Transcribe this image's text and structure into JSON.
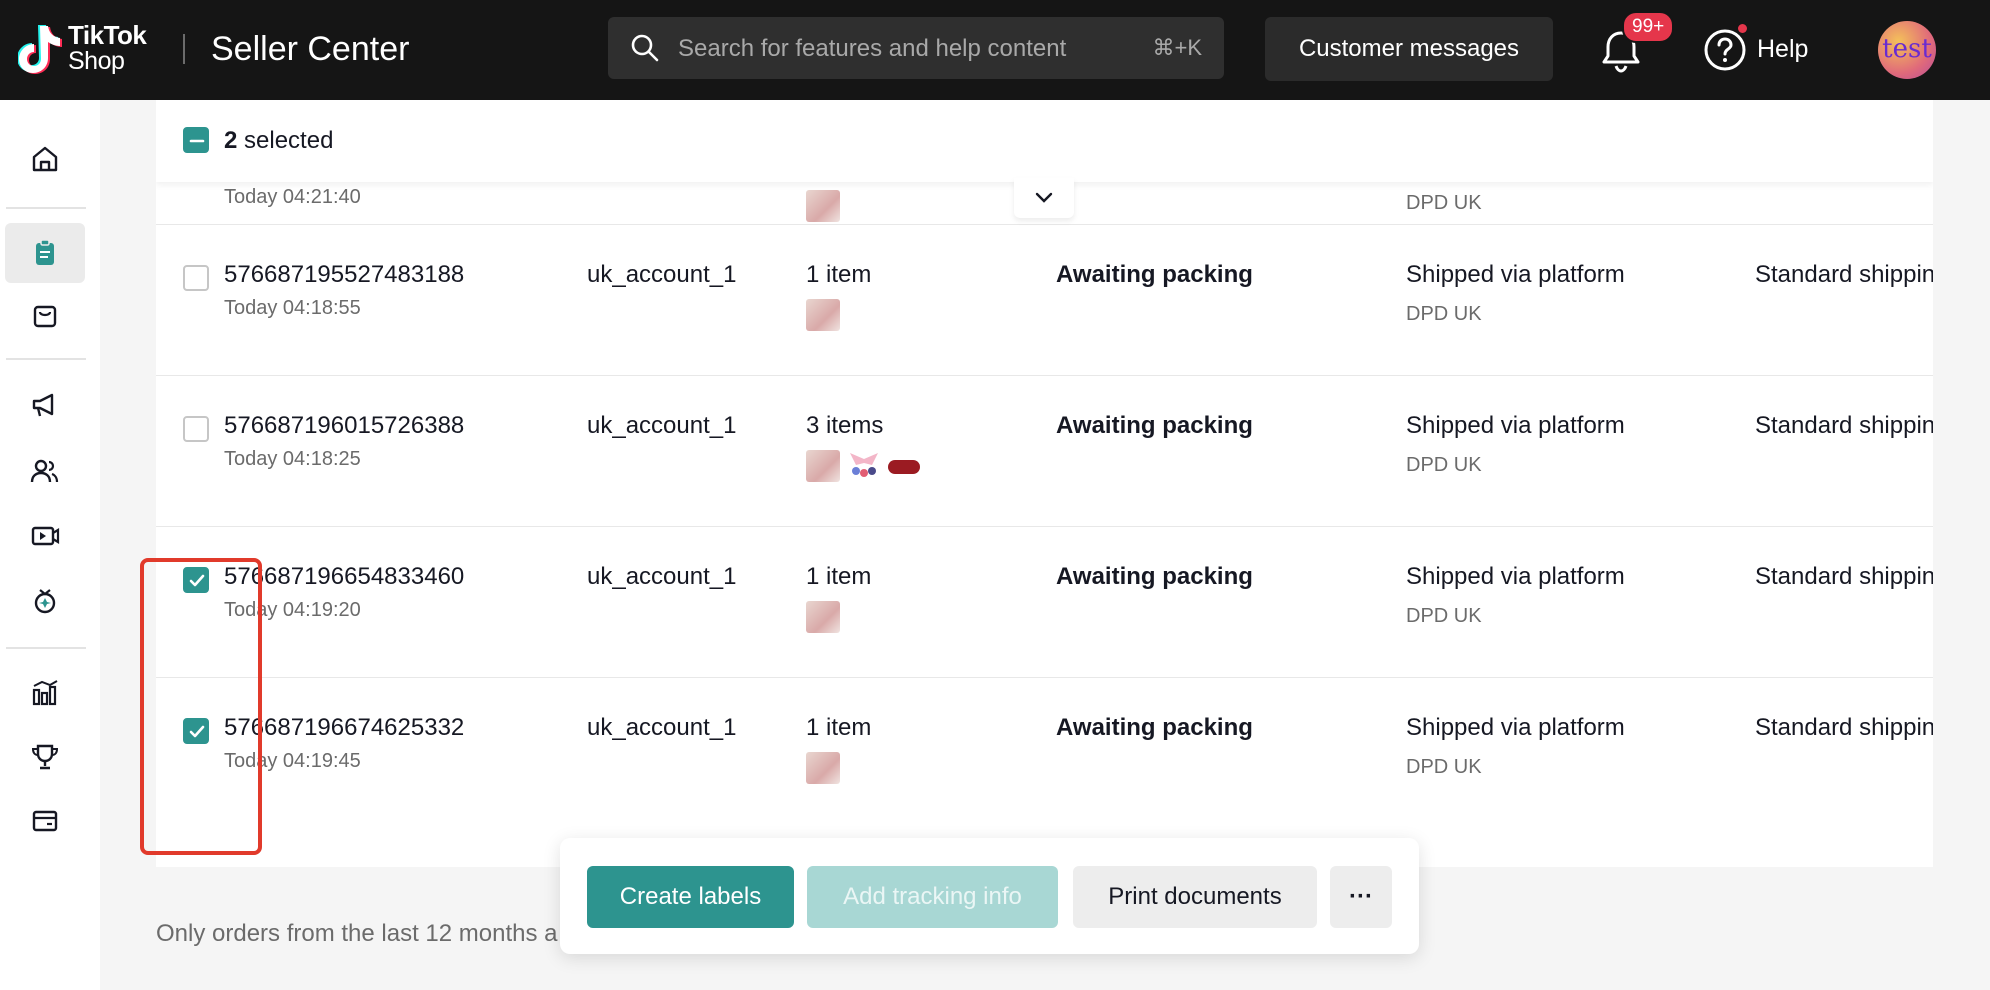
{
  "topbar": {
    "brand_line1": "TikTok",
    "brand_line2": "Shop",
    "title": "Seller Center",
    "search_placeholder": "Search for features and help content",
    "search_shortcut": "⌘+K",
    "customer_messages": "Customer messages",
    "notification_badge": "99+",
    "help_label": "Help",
    "avatar_text": "test"
  },
  "sidebar": {
    "items": [
      {
        "icon": "home-icon"
      },
      {
        "icon": "orders-icon",
        "active": true
      },
      {
        "icon": "products-icon"
      },
      {
        "icon": "marketing-icon"
      },
      {
        "icon": "creators-icon"
      },
      {
        "icon": "live-video-icon"
      },
      {
        "icon": "growth-icon"
      },
      {
        "icon": "analytics-icon"
      },
      {
        "icon": "trophy-icon"
      },
      {
        "icon": "finance-icon"
      }
    ]
  },
  "selection": {
    "count": "2",
    "label": "selected"
  },
  "rows": [
    {
      "id": "",
      "time": "Today 04:21:40",
      "account": "",
      "items": "",
      "status": "",
      "shipping": "",
      "carrier": "DPD UK",
      "method": "",
      "checked": false
    },
    {
      "id": "576687195527483188",
      "time": "Today 04:18:55",
      "account": "uk_account_1",
      "items": "1 item",
      "status": "Awaiting packing",
      "shipping": "Shipped via platform",
      "carrier": "DPD UK",
      "method": "Standard shippin",
      "checked": false
    },
    {
      "id": "576687196015726388",
      "time": "Today 04:18:25",
      "account": "uk_account_1",
      "items": "3 items",
      "status": "Awaiting packing",
      "shipping": "Shipped via platform",
      "carrier": "DPD UK",
      "method": "Standard shippin",
      "checked": false
    },
    {
      "id": "576687196654833460",
      "time": "Today 04:19:20",
      "account": "uk_account_1",
      "items": "1 item",
      "status": "Awaiting packing",
      "shipping": "Shipped via platform",
      "carrier": "DPD UK",
      "method": "Standard shippin",
      "checked": true
    },
    {
      "id": "576687196674625332",
      "time": "Today 04:19:45",
      "account": "uk_account_1",
      "items": "1 item",
      "status": "Awaiting packing",
      "shipping": "Shipped via platform",
      "carrier": "DPD UK",
      "method": "Standard shippin",
      "checked": true
    }
  ],
  "footnote": "Only orders from the last 12 months a",
  "actions": {
    "create_labels": "Create labels",
    "add_tracking": "Add tracking info",
    "print_documents": "Print documents",
    "more": "···"
  },
  "colors": {
    "accent": "#2d948f",
    "topbar": "#151515",
    "highlight": "#e13a2b",
    "badge": "#e5364b"
  }
}
